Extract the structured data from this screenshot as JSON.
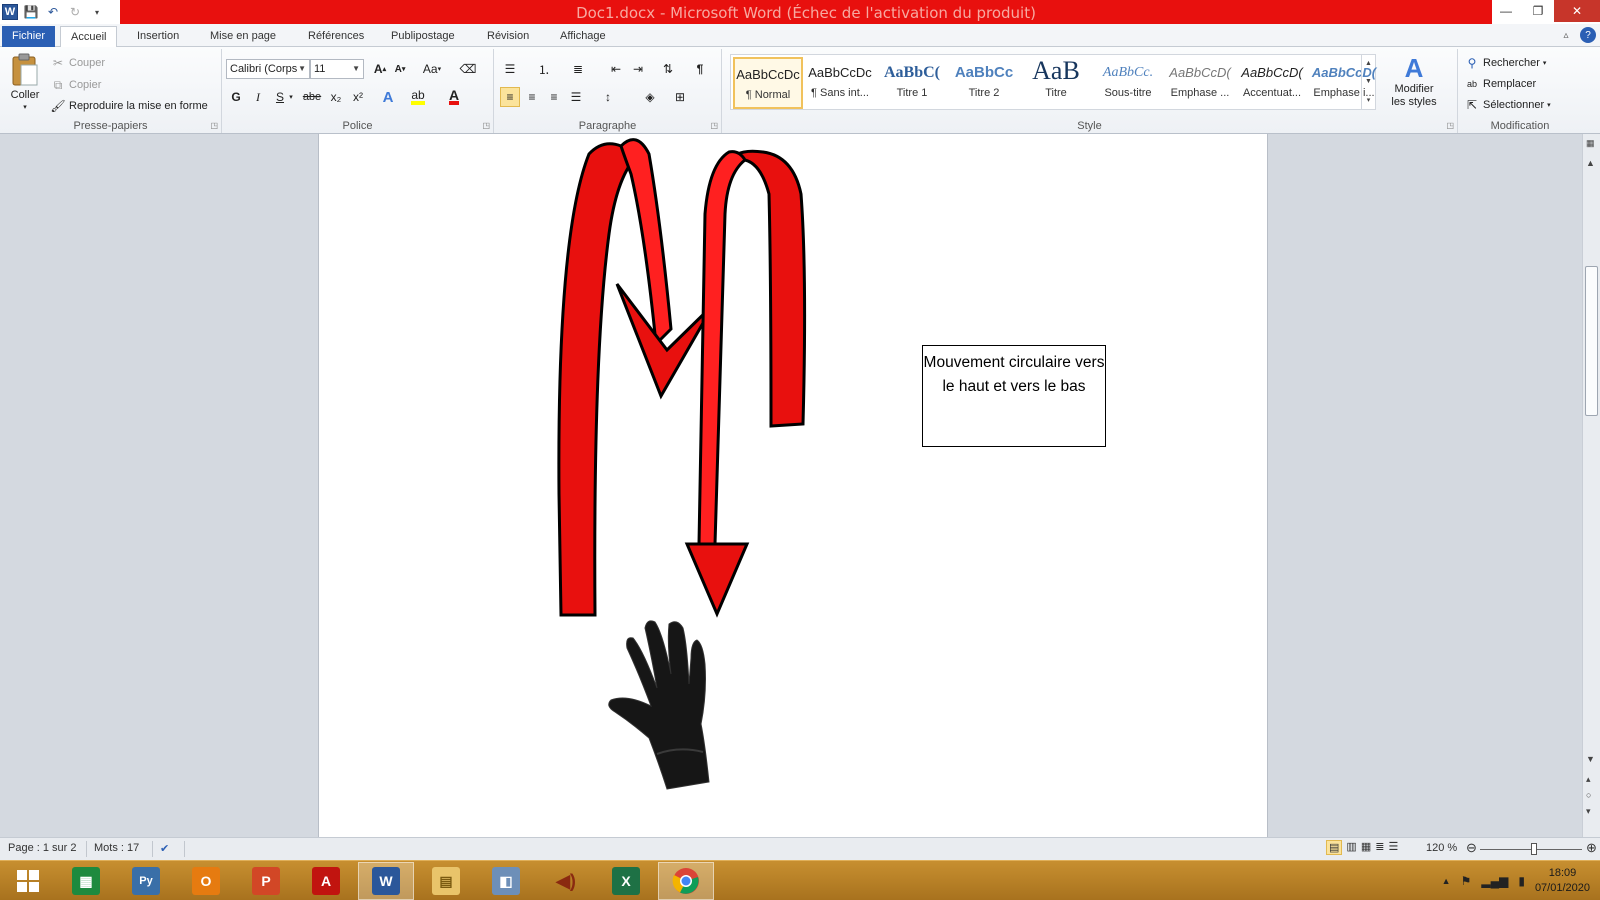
{
  "window": {
    "title": "Doc1.docx - Microsoft Word (Échec de l'activation du produit)",
    "controls": [
      "—",
      "❐",
      "✕"
    ]
  },
  "tabs": [
    "Fichier",
    "Accueil",
    "Insertion",
    "Mise en page",
    "Références",
    "Publipostage",
    "Révision",
    "Affichage"
  ],
  "ribbon": {
    "clipboard": {
      "paste_label": "Coller",
      "cut_label": "Couper",
      "copy_label": "Copier",
      "format_painter_label": "Reproduire la mise en forme",
      "group_label": "Presse-papiers"
    },
    "font": {
      "font_name": "Calibri (Corps",
      "font_size": "11",
      "bold": "G",
      "italic": "I",
      "underline": "S",
      "strike": "abe",
      "subscript": "x₂",
      "superscript": "x²",
      "change_case": "Aa",
      "group_label": "Police"
    },
    "paragraph": {
      "group_label": "Paragraphe"
    },
    "styles": {
      "items": [
        {
          "preview": "AaBbCcDc",
          "name": "¶ Normal"
        },
        {
          "preview": "AaBbCcDc",
          "name": "¶ Sans int..."
        },
        {
          "preview": "AaBbC(",
          "name": "Titre 1"
        },
        {
          "preview": "AaBbCc",
          "name": "Titre 2"
        },
        {
          "preview": "AaB",
          "name": "Titre"
        },
        {
          "preview": "AaBbCc.",
          "name": "Sous-titre"
        },
        {
          "preview": "AaBbCcD(",
          "name": "Emphase ..."
        },
        {
          "preview": "AaBbCcD(",
          "name": "Accentuat..."
        },
        {
          "preview": "AaBbCcD(",
          "name": "Emphase i..."
        }
      ],
      "change_styles_label_1": "Modifier",
      "change_styles_label_2": "les styles",
      "group_label": "Style"
    },
    "editing": {
      "find_label": "Rechercher",
      "replace_label": "Remplacer",
      "select_label": "Sélectionner",
      "group_label": "Modification"
    }
  },
  "document": {
    "textbox_text": "Mouvement circulaire vers le haut et vers le bas",
    "arrow_color": "#e8100e",
    "arrow_color_light": "#ff2020"
  },
  "statusbar": {
    "page": "Page : 1 sur 2",
    "words": "Mots : 17",
    "zoom": "120 %",
    "zoom_level": 120
  },
  "taskbar": {
    "apps": [
      {
        "name": "windows-start",
        "label": "⊞"
      },
      {
        "name": "microsoft-store",
        "label": "▦"
      },
      {
        "name": "python",
        "label": "Py"
      },
      {
        "name": "outlook",
        "label": "O"
      },
      {
        "name": "powerpoint",
        "label": "P"
      },
      {
        "name": "acrobat",
        "label": "A"
      },
      {
        "name": "word",
        "label": "W"
      },
      {
        "name": "file-explorer",
        "label": "▤"
      },
      {
        "name": "photos",
        "label": "◧"
      },
      {
        "name": "audio",
        "label": "◀)"
      },
      {
        "name": "excel",
        "label": "X"
      },
      {
        "name": "chrome",
        "label": "◉"
      }
    ],
    "clock_time": "18:09",
    "clock_date": "07/01/2020"
  }
}
